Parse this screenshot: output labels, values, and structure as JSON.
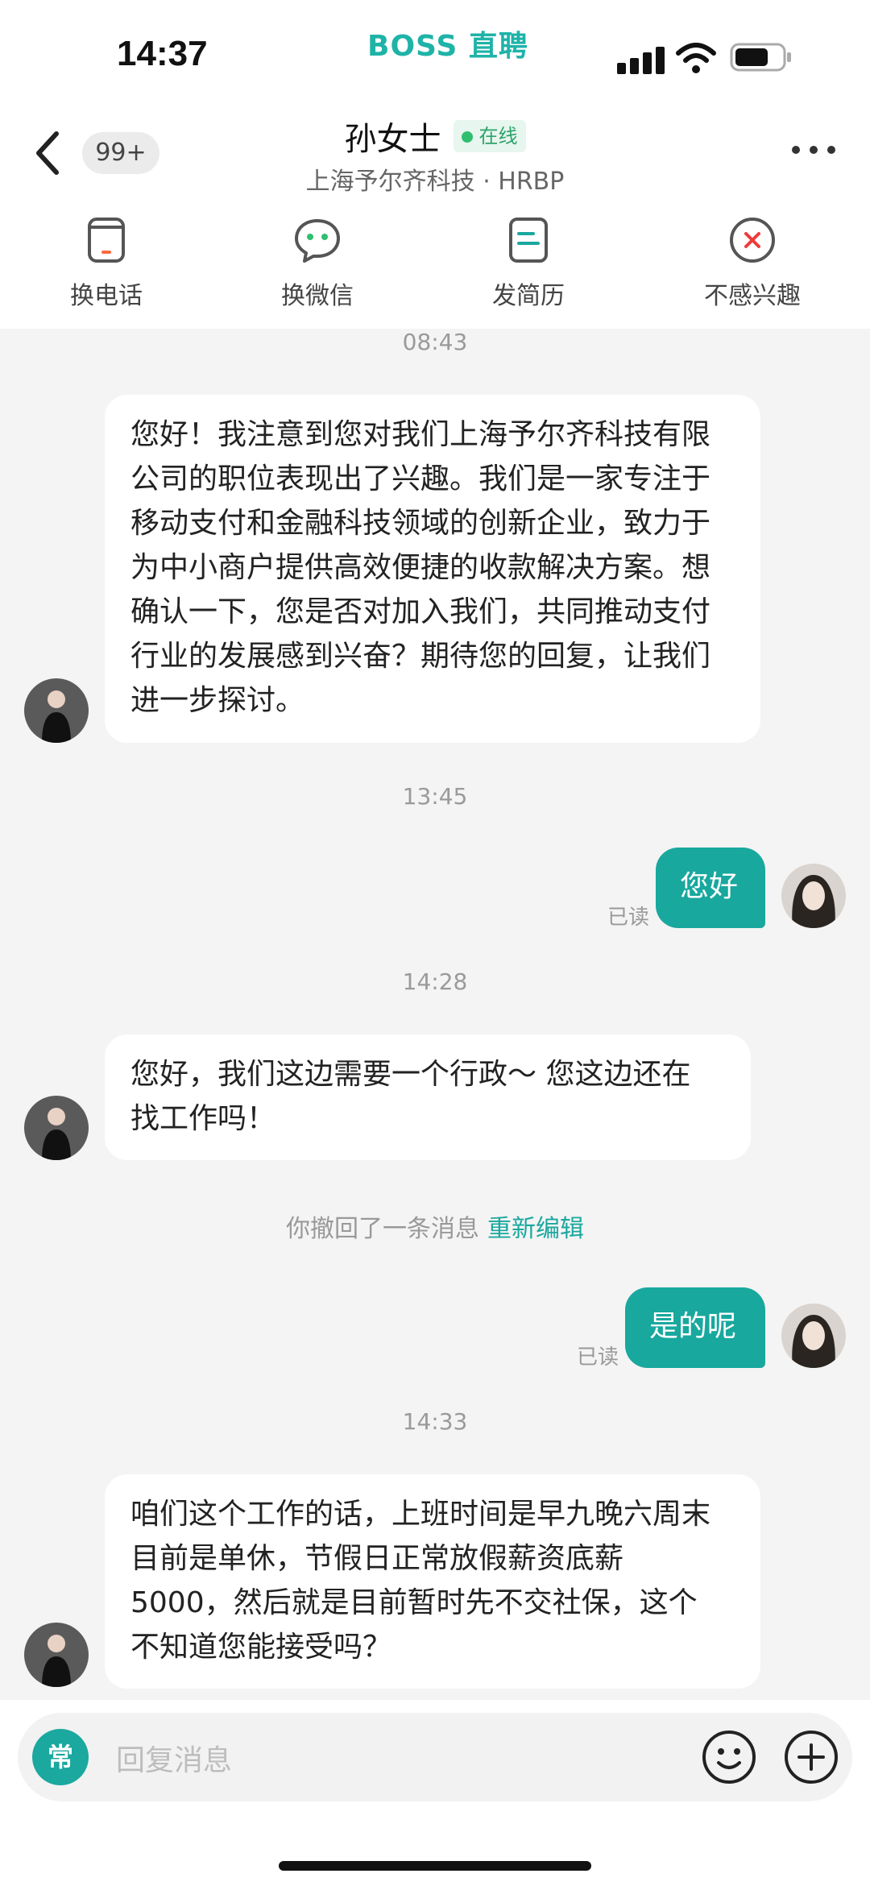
{
  "status": {
    "time": "14:37",
    "brand": "BOSS 直聘"
  },
  "header": {
    "badge": "99+",
    "name": "孙女士",
    "online": "在线",
    "subtitle": "上海予尔齐科技 · HRBP"
  },
  "actions": [
    {
      "label": "换电话",
      "icon": "phone-icon"
    },
    {
      "label": "换微信",
      "icon": "wechat-icon"
    },
    {
      "label": "发简历",
      "icon": "resume-icon"
    },
    {
      "label": "不感兴趣",
      "icon": "close-circle-icon"
    }
  ],
  "messages": {
    "t1": "08:43",
    "m1": [
      "您好！我注意到您对我们上海予尔齐科技有限",
      "公司的职位表现出了兴趣。我们是一家专注于",
      "移动支付和金融科技领域的创新企业，致力于",
      "为中小商户提供高效便捷的收款解决方案。想",
      "确认一下，您是否对加入我们，共同推动支付",
      "行业的发展感到兴奋？期待您的回复，让我们",
      "进一步探讨。"
    ],
    "t2": "13:45",
    "r1": "您好",
    "read": "已读",
    "t3": "14:28",
    "m2": [
      "您好，我们这边需要一个行政～  您这边还在",
      "找工作吗！"
    ],
    "recall_text": "你撤回了一条消息",
    "recall_link": "重新编辑",
    "r2": "是的呢",
    "t4": "14:33",
    "m3": [
      "咱们这个工作的话，上班时间是早九晚六周末",
      "目前是单休，节假日正常放假薪资底薪",
      "5000，然后就是目前暂时先不交社保，这个",
      "不知道您能接受吗？"
    ]
  },
  "input": {
    "quick": "常",
    "placeholder": "回复消息"
  },
  "colors": {
    "accent": "#1aa89f",
    "online": "#2fbf6f"
  }
}
